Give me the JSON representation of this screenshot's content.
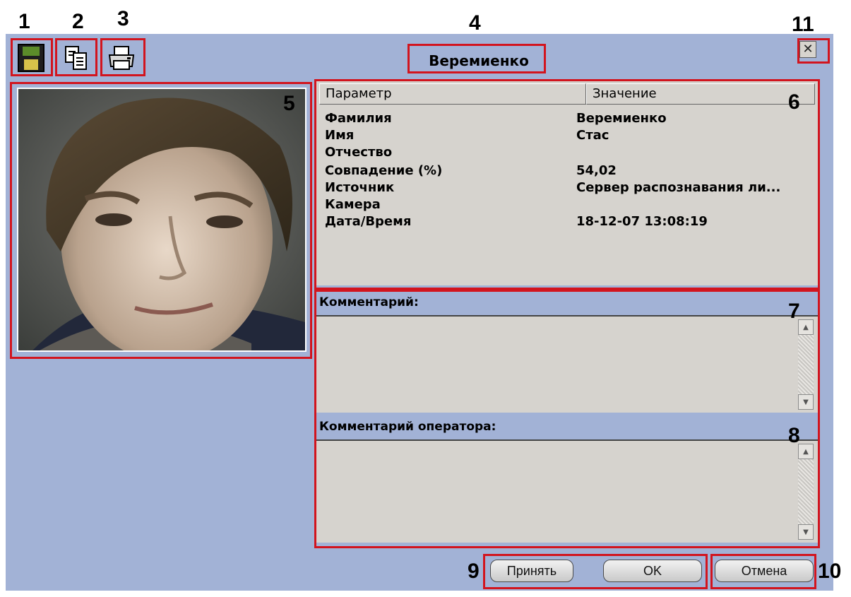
{
  "callouts": [
    "1",
    "2",
    "3",
    "4",
    "5",
    "6",
    "7",
    "8",
    "9",
    "10",
    "11"
  ],
  "window": {
    "title": "Веремиенко",
    "toolbar": {
      "save_icon": "floppy-disk-icon",
      "copy_icon": "copy-icon",
      "print_icon": "printer-icon"
    },
    "close_glyph": "✕"
  },
  "params": {
    "headers": [
      "Параметр",
      "Значение"
    ],
    "rows": [
      {
        "label": "Фамилия",
        "value": "Веремиенко"
      },
      {
        "label": "Имя",
        "value": "Стас"
      },
      {
        "label": "Отчество",
        "value": ""
      },
      {
        "label": "Совпадение (%)",
        "value": "54,02"
      },
      {
        "label": "Источник",
        "value": "Сервер распознавания ли..."
      },
      {
        "label": "Камера",
        "value": ""
      },
      {
        "label": "Дата/Время",
        "value": "18-12-07 13:08:19"
      }
    ]
  },
  "comment": {
    "label": "Комментарий:",
    "value": ""
  },
  "operator_comment": {
    "label": "Комментарий оператора:",
    "value": ""
  },
  "buttons": {
    "accept": "Принять",
    "ok": "OK",
    "cancel": "Отмена"
  },
  "colors": {
    "window_bg": "#a2b2d6",
    "panel_bg": "#d6d3ce",
    "callout_box": "#d2141e"
  }
}
